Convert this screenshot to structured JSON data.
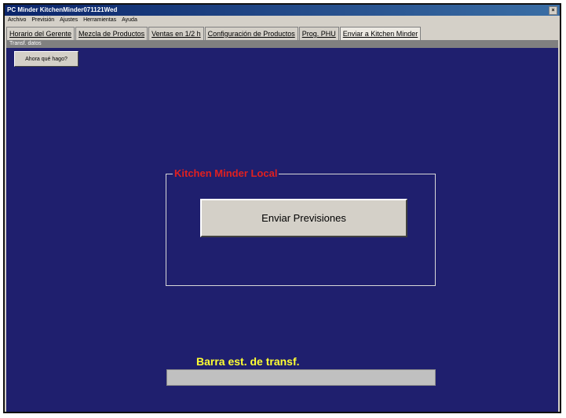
{
  "window": {
    "title": "PC Minder KitchenMinder071121Wed",
    "close_glyph": "×"
  },
  "menu": [
    "Archivo",
    "Previsión",
    "Ajustes",
    "Herramientas",
    "Ayuda"
  ],
  "tabs": [
    {
      "label": "Horario del Gerente",
      "active": false
    },
    {
      "label": "Mezcla de Productos",
      "active": false
    },
    {
      "label": "Ventas en 1/2 h",
      "active": false
    },
    {
      "label": "Configuración de Productos",
      "active": false
    },
    {
      "label": "Prog. PHU",
      "active": false
    },
    {
      "label": "Enviar a Kitchen Minder",
      "active": true
    }
  ],
  "section": {
    "label": "Transf. datos"
  },
  "help_button": {
    "label": "Ahora qué hago?"
  },
  "group": {
    "title": "Kitchen Minder Local",
    "send_label": "Enviar Previsiones"
  },
  "status": {
    "label": "Barra est. de transf.",
    "progress": 0
  },
  "colors": {
    "background": "#1f1f6e",
    "group_title": "#e02020",
    "status_label": "#ffff33"
  }
}
